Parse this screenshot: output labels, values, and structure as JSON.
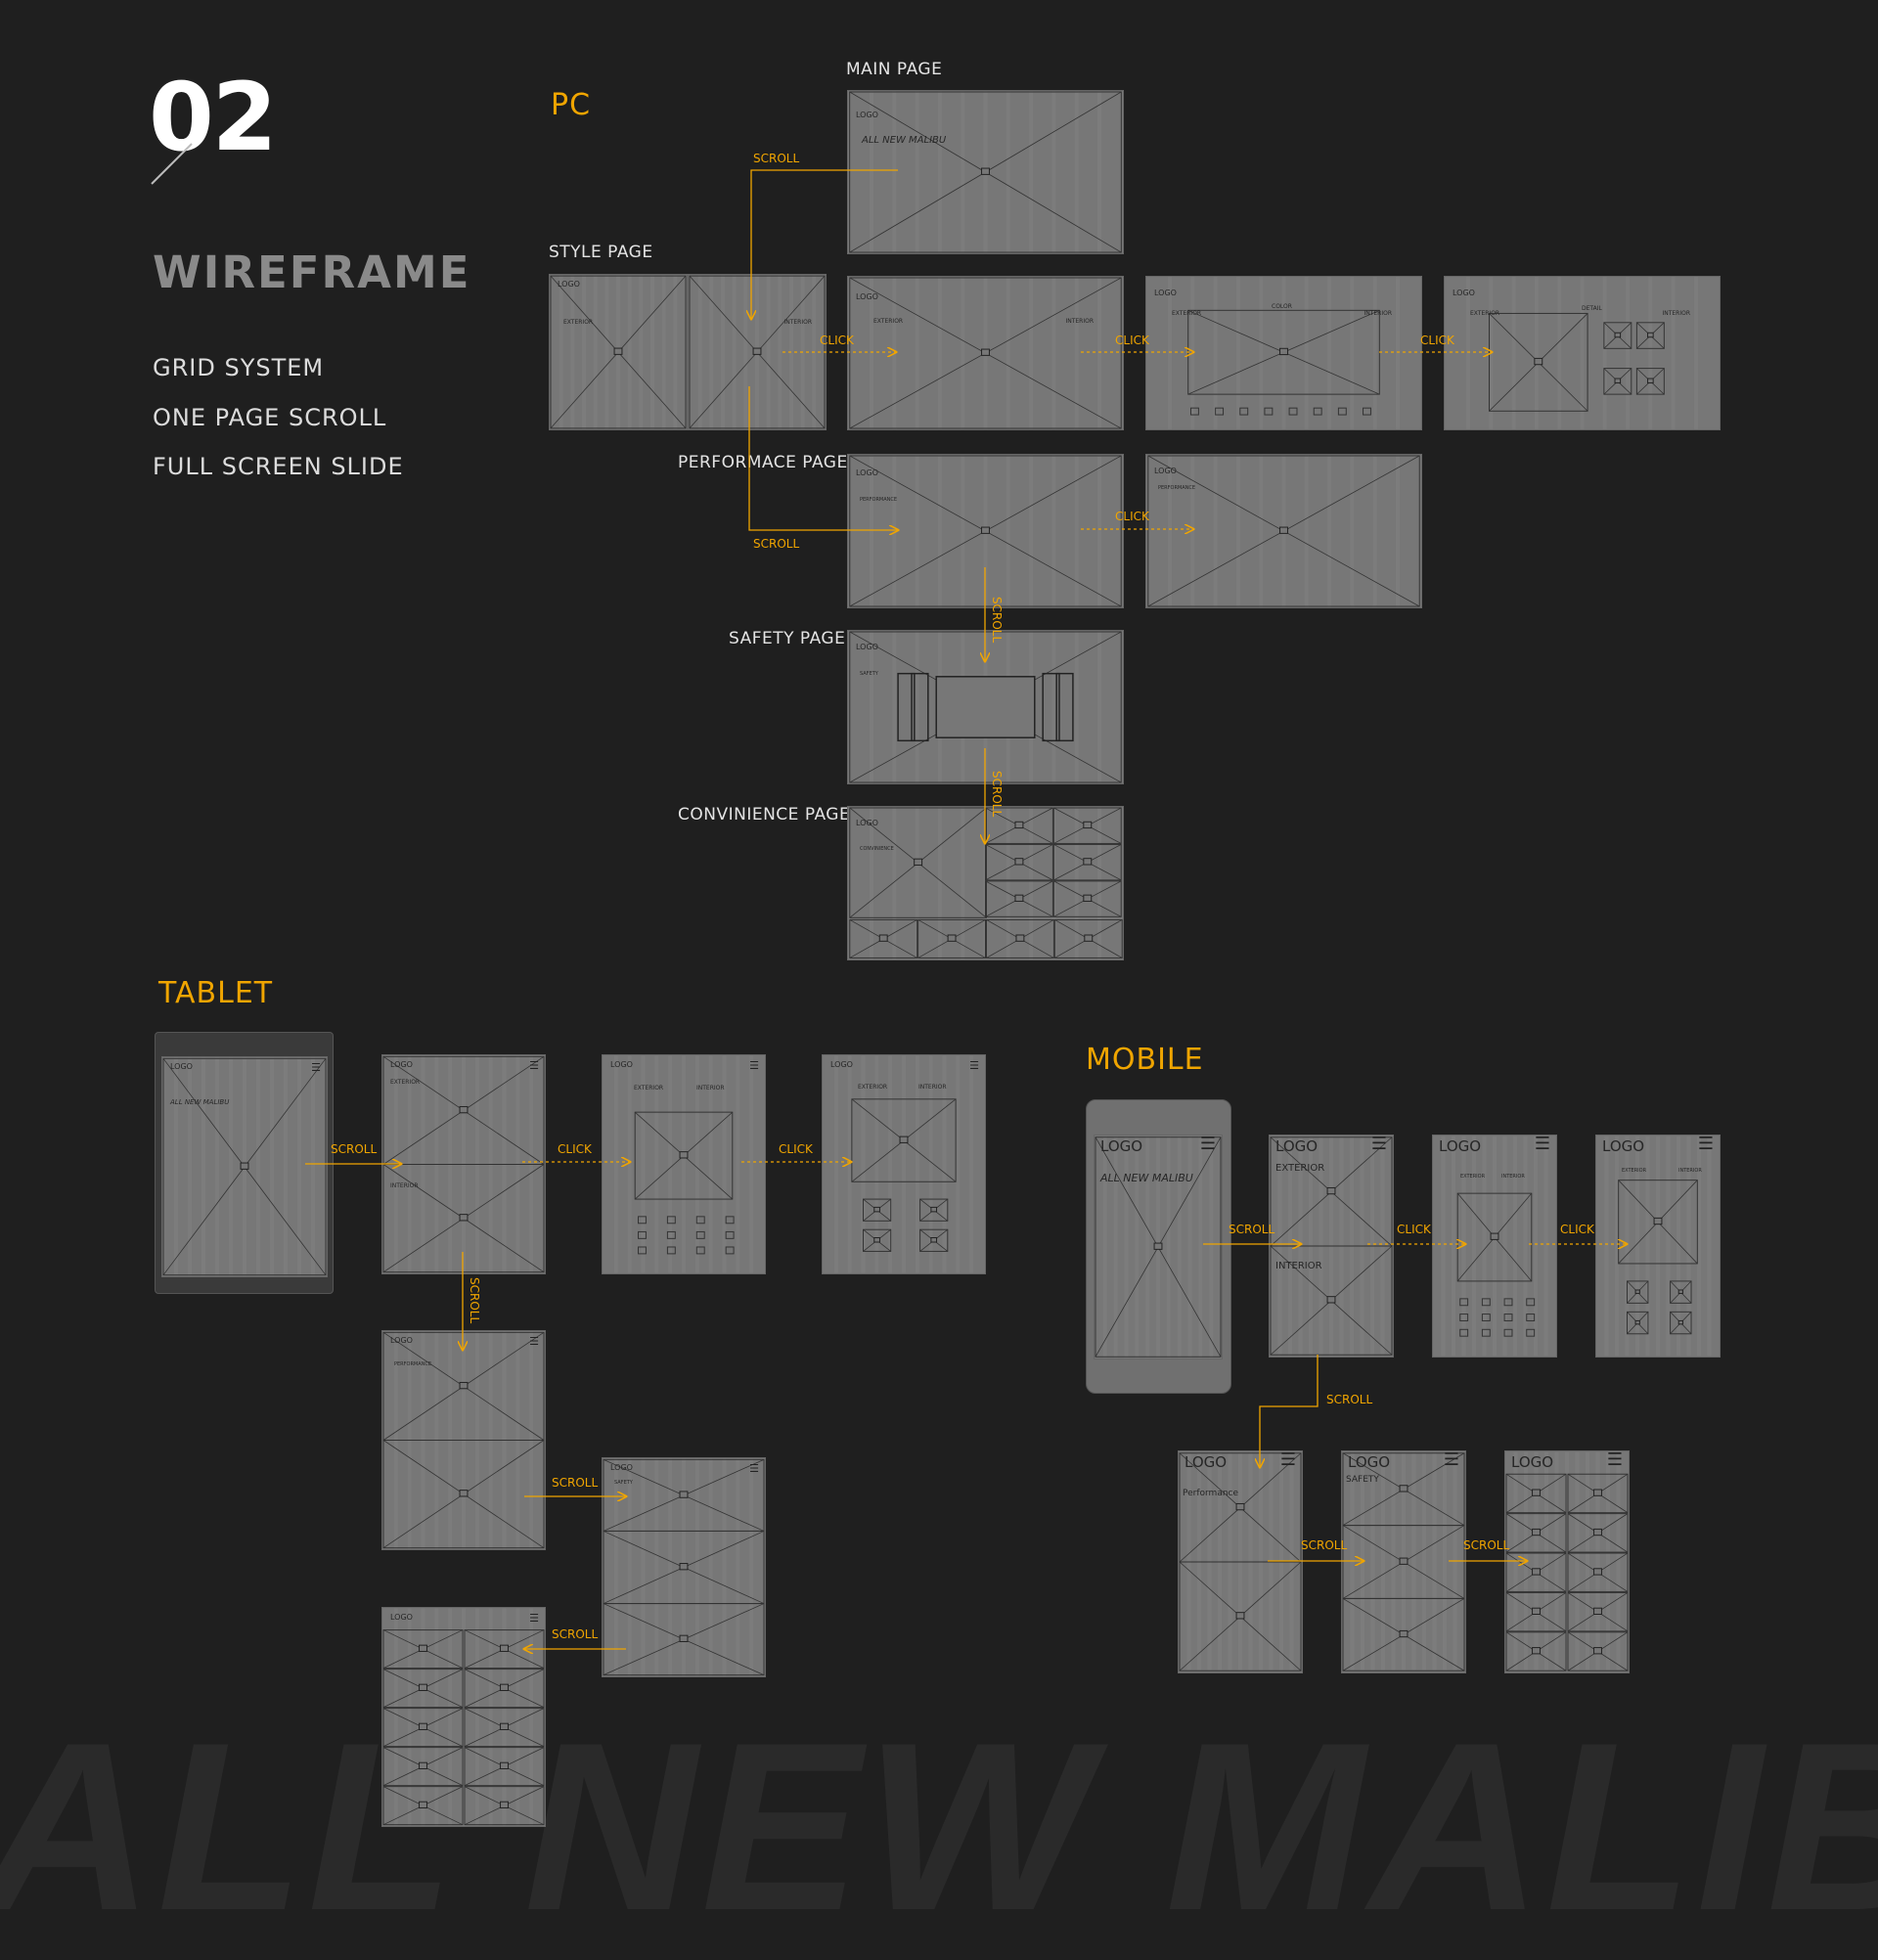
{
  "header": {
    "number": "02",
    "title": "WIREFRAME",
    "features": [
      "GRID SYSTEM",
      "ONE PAGE SCROLL",
      "FULL SCREEN SLIDE"
    ]
  },
  "sections": {
    "pc": "PC",
    "tablet": "TABLET",
    "mobile": "MOBILE"
  },
  "pc_pages": {
    "main": "MAIN PAGE",
    "style": "STYLE PAGE",
    "performance": "PERFORMACE PAGE",
    "safety": "SAFETY PAGE",
    "convenience": "CONVINIENCE PAGE"
  },
  "wire_text": {
    "logo": "LOGO",
    "logo_large": "LOGO",
    "main_title": "ALL NEW MALIBU",
    "exterior": "EXTERIOR",
    "interior": "INTERIOR",
    "exterior_mixed": "Exterior",
    "interior_mixed": "Interior",
    "color": "COLOR",
    "detail": "DETAIL",
    "performance": "PERFORMANCE",
    "performance_mixed": "Performance",
    "safety": "SAFETY",
    "convenience": "CONVINIENCE"
  },
  "annotations": {
    "scroll": "SCROLL",
    "click": "CLICK"
  },
  "background_text": "ALL NEW MALIBU",
  "colors": {
    "background": "#1f1f1f",
    "accent": "#f0a500",
    "wireframe": "#777777",
    "title_gray": "#8a8a8a"
  }
}
